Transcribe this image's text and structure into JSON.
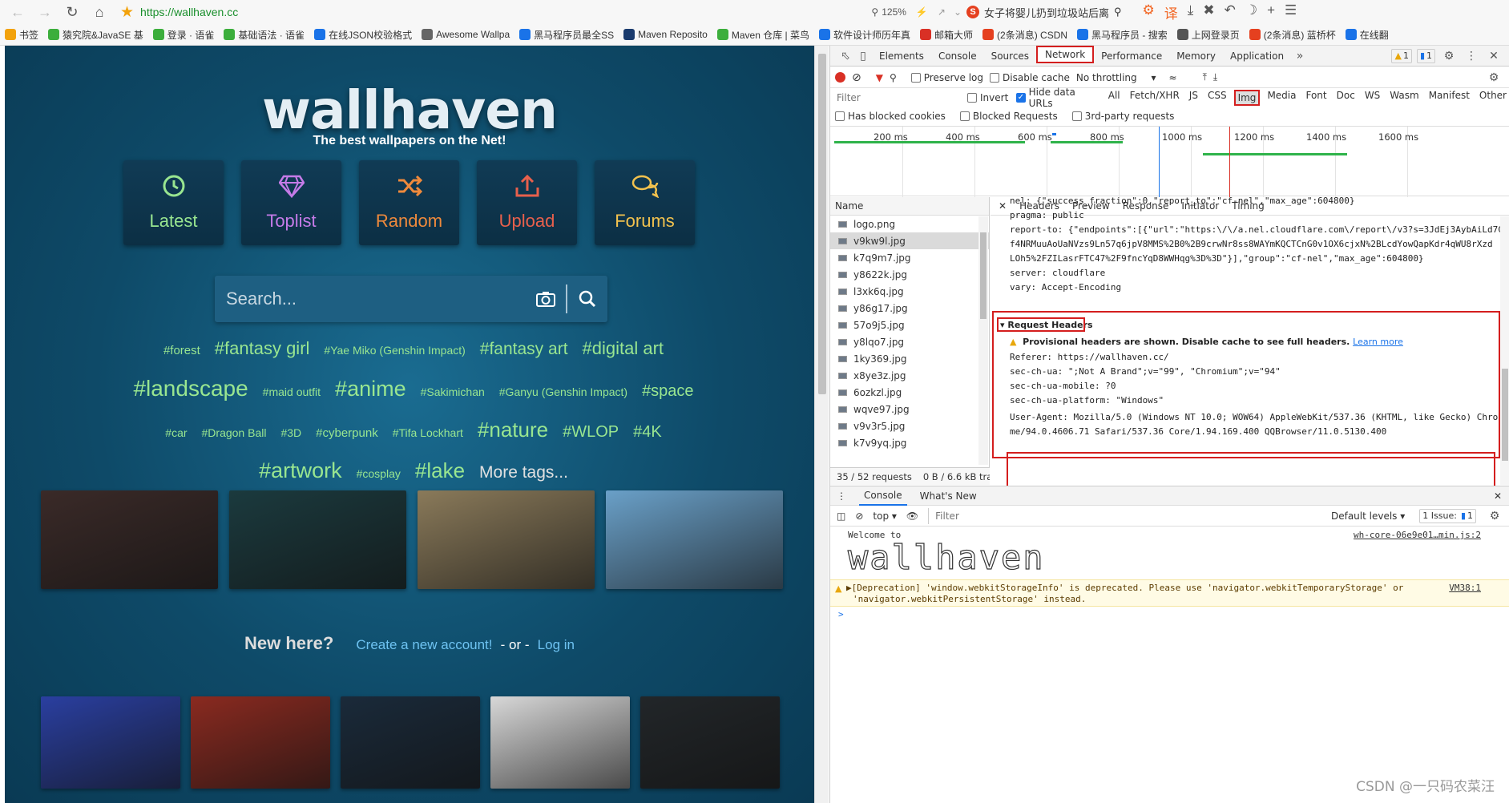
{
  "browser": {
    "url": "https://wallhaven.cc",
    "zoom": "125%",
    "news_text": "女子将婴儿扔到垃圾站后离",
    "bookmarks": [
      {
        "label": "书签",
        "color": "#f2a20c"
      },
      {
        "label": "猿究院&JavaSE 基",
        "color": "#3cae3c"
      },
      {
        "label": "登录 · 语雀",
        "color": "#3cae3c"
      },
      {
        "label": "基础语法 · 语雀",
        "color": "#3cae3c"
      },
      {
        "label": "在线JSON校验格式",
        "color": "#1a73e8"
      },
      {
        "label": "Awesome Wallpa",
        "color": "#666666"
      },
      {
        "label": "黑马程序员最全SS",
        "color": "#1a73e8"
      },
      {
        "label": "Maven Reposito",
        "color": "#1a3b6e"
      },
      {
        "label": "Maven 仓库 | 菜鸟",
        "color": "#3cae3c"
      },
      {
        "label": "软件设计师历年真",
        "color": "#1a73e8"
      },
      {
        "label": "邮箱大师",
        "color": "#d93025"
      },
      {
        "label": "(2条消息) CSDN",
        "color": "#e5401f"
      },
      {
        "label": "黑马程序员 - 搜索",
        "color": "#1a73e8"
      },
      {
        "label": "上网登录页",
        "color": "#555555"
      },
      {
        "label": "(2条消息) 蓝桥杯",
        "color": "#e5401f"
      },
      {
        "label": "在线翻",
        "color": "#1a73e8"
      }
    ]
  },
  "site": {
    "logo": "wallhaven",
    "tagline": "The best wallpapers on the Net!",
    "nav": [
      {
        "label": "Latest",
        "icon": "clock-icon",
        "color": "#99e690"
      },
      {
        "label": "Toplist",
        "icon": "diamond-icon",
        "color": "#c57be8"
      },
      {
        "label": "Random",
        "icon": "shuffle-icon",
        "color": "#ef8a3c"
      },
      {
        "label": "Upload",
        "icon": "upload-icon",
        "color": "#e8604c"
      },
      {
        "label": "Forums",
        "icon": "comments-icon",
        "color": "#f2c24e"
      }
    ],
    "search_placeholder": "Search...",
    "tags": [
      {
        "label": "#forest",
        "size": 15
      },
      {
        "label": "#fantasy girl",
        "size": 22
      },
      {
        "label": "#Yae Miko (Genshin Impact)",
        "size": 14
      },
      {
        "label": "#fantasy art",
        "size": 21
      },
      {
        "label": "#digital art",
        "size": 22
      },
      {
        "label": "#landscape",
        "size": 28
      },
      {
        "label": "#maid outfit",
        "size": 14
      },
      {
        "label": "#anime",
        "size": 27
      },
      {
        "label": "#Sakimichan",
        "size": 14
      },
      {
        "label": "#Ganyu (Genshin Impact)",
        "size": 14
      },
      {
        "label": "#space",
        "size": 20
      },
      {
        "label": "#car",
        "size": 14
      },
      {
        "label": "#Dragon Ball",
        "size": 14
      },
      {
        "label": "#3D",
        "size": 14
      },
      {
        "label": "#cyberpunk",
        "size": 15
      },
      {
        "label": "#Tifa Lockhart",
        "size": 14
      },
      {
        "label": "#nature",
        "size": 26
      },
      {
        "label": "#WLOP",
        "size": 20
      },
      {
        "label": "#4K",
        "size": 20
      },
      {
        "label": "#artwork",
        "size": 27
      },
      {
        "label": "#cosplay",
        "size": 14
      },
      {
        "label": "#lake",
        "size": 26
      },
      {
        "label": "More tags...",
        "size": 21,
        "more": true
      }
    ],
    "new_here": {
      "title": "New here?",
      "create": "Create a new account!",
      "sep": "- or -",
      "login": "Log in"
    },
    "thumbs_row1": [
      "#3a2a28",
      "#1b3a3e",
      "#8a7a5a",
      "#6aa0c8"
    ],
    "thumbs_row2": [
      "#2a3fa0",
      "#8a2a20",
      "#1a2a3a",
      "#d8d8d8",
      "#222629"
    ]
  },
  "devtools": {
    "tabs": [
      "Elements",
      "Console",
      "Sources",
      "Network",
      "Performance",
      "Memory",
      "Application"
    ],
    "active_tab": "Network",
    "warn_count": "1",
    "msg_count": "1",
    "net_toolbar": {
      "preserve": "Preserve log",
      "disable_cache": "Disable cache",
      "throttle": "No throttling"
    },
    "filter_placeholder": "Filter",
    "invert": "Invert",
    "hide_data": "Hide data URLs",
    "types": [
      "All",
      "Fetch/XHR",
      "JS",
      "CSS",
      "Img",
      "Media",
      "Font",
      "Doc",
      "WS",
      "Wasm",
      "Manifest",
      "Other"
    ],
    "active_type": "Img",
    "blocked": [
      "Has blocked cookies",
      "Blocked Requests",
      "3rd-party requests"
    ],
    "timeline_labels": [
      "200 ms",
      "400 ms",
      "600 ms",
      "800 ms",
      "1000 ms",
      "1200 ms",
      "1400 ms",
      "1600 ms"
    ],
    "name_header": "Name",
    "requests": [
      "logo.png",
      "v9kw9l.jpg",
      "k7q9m7.jpg",
      "y8622k.jpg",
      "l3xk6q.jpg",
      "y86g17.jpg",
      "57o9j5.jpg",
      "y8lqo7.jpg",
      "1ky369.jpg",
      "x8ye3z.jpg",
      "6ozkzl.jpg",
      "wqve97.jpg",
      "v9v3r5.jpg",
      "k7v9yq.jpg"
    ],
    "selected_request": "v9kw9l.jpg",
    "status_requests": "35 / 52 requests",
    "status_transfer": "0 B / 6.6 kB tran",
    "detail_tabs": [
      "Headers",
      "Preview",
      "Response",
      "Initiator",
      "Timing"
    ],
    "headers_top": [
      {
        "k": "nel:",
        "v": "{\"success_fraction\":0,\"report_to\":\"cf-nel\",\"max_age\":604800}"
      },
      {
        "k": "pragma:",
        "v": "public"
      },
      {
        "k": "report-to:",
        "v": "{\"endpoints\":[{\"url\":\"https:\\/\\/a.nel.cloudflare.com\\/report\\/v3?s=3JdEj3AybAiLd7C"
      },
      {
        "k": "",
        "v": "f4NRMuuAoUaNVzs9Ln57q6jpV8MMS%2B0%2B9crwNr8ss8WAYmKQCTCnG0v1OX6cjxN%2BLcdYowQapKdr4qWU8rXzd"
      },
      {
        "k": "",
        "v": "LOh5%2FZILasrFTC47%2F9fncYqD8WWHqg%3D%3D\"}],\"group\":\"cf-nel\",\"max_age\":604800}"
      },
      {
        "k": "server:",
        "v": "cloudflare"
      },
      {
        "k": "vary:",
        "v": "Accept-Encoding"
      }
    ],
    "request_headers_title": "Request Headers",
    "provisional_warning": "Provisional headers are shown. Disable cache to see full headers.",
    "learn_more": "Learn more",
    "request_headers": [
      {
        "k": "Referer:",
        "v": "https://wallhaven.cc/"
      },
      {
        "k": "sec-ch-ua:",
        "v": "\";Not A Brand\";v=\"99\", \"Chromium\";v=\"94\""
      },
      {
        "k": "sec-ch-ua-mobile:",
        "v": "?0"
      },
      {
        "k": "sec-ch-ua-platform:",
        "v": "\"Windows\""
      }
    ],
    "user_agent_key": "User-Agent:",
    "user_agent_l1": "Mozilla/5.0 (Windows NT 10.0; WOW64) AppleWebKit/537.36 (KHTML, like Gecko) Chro",
    "user_agent_l2": "me/94.0.4606.71 Safari/537.36 Core/1.94.169.400 QQBrowser/11.0.5130.400",
    "drawer_tabs": [
      "Console",
      "What's New"
    ],
    "console_context": "top",
    "console_filter": "Filter",
    "default_levels": "Default levels",
    "issues": "1 Issue:",
    "issues_count": "1",
    "welcome": "Welcome to",
    "welcome_src": "wh-core-06e9e01…min.js:2",
    "ascii_art": "wallhaven",
    "deprecation_l1": "▶[Deprecation] 'window.webkitStorageInfo' is deprecated. Please use 'navigator.webkitTemporaryStorage' or",
    "deprecation_l2": "'navigator.webkitPersistentStorage' instead.",
    "deprecation_src": "VM38:1",
    "prompt": ">"
  },
  "watermark": "CSDN @一只码农菜汪"
}
